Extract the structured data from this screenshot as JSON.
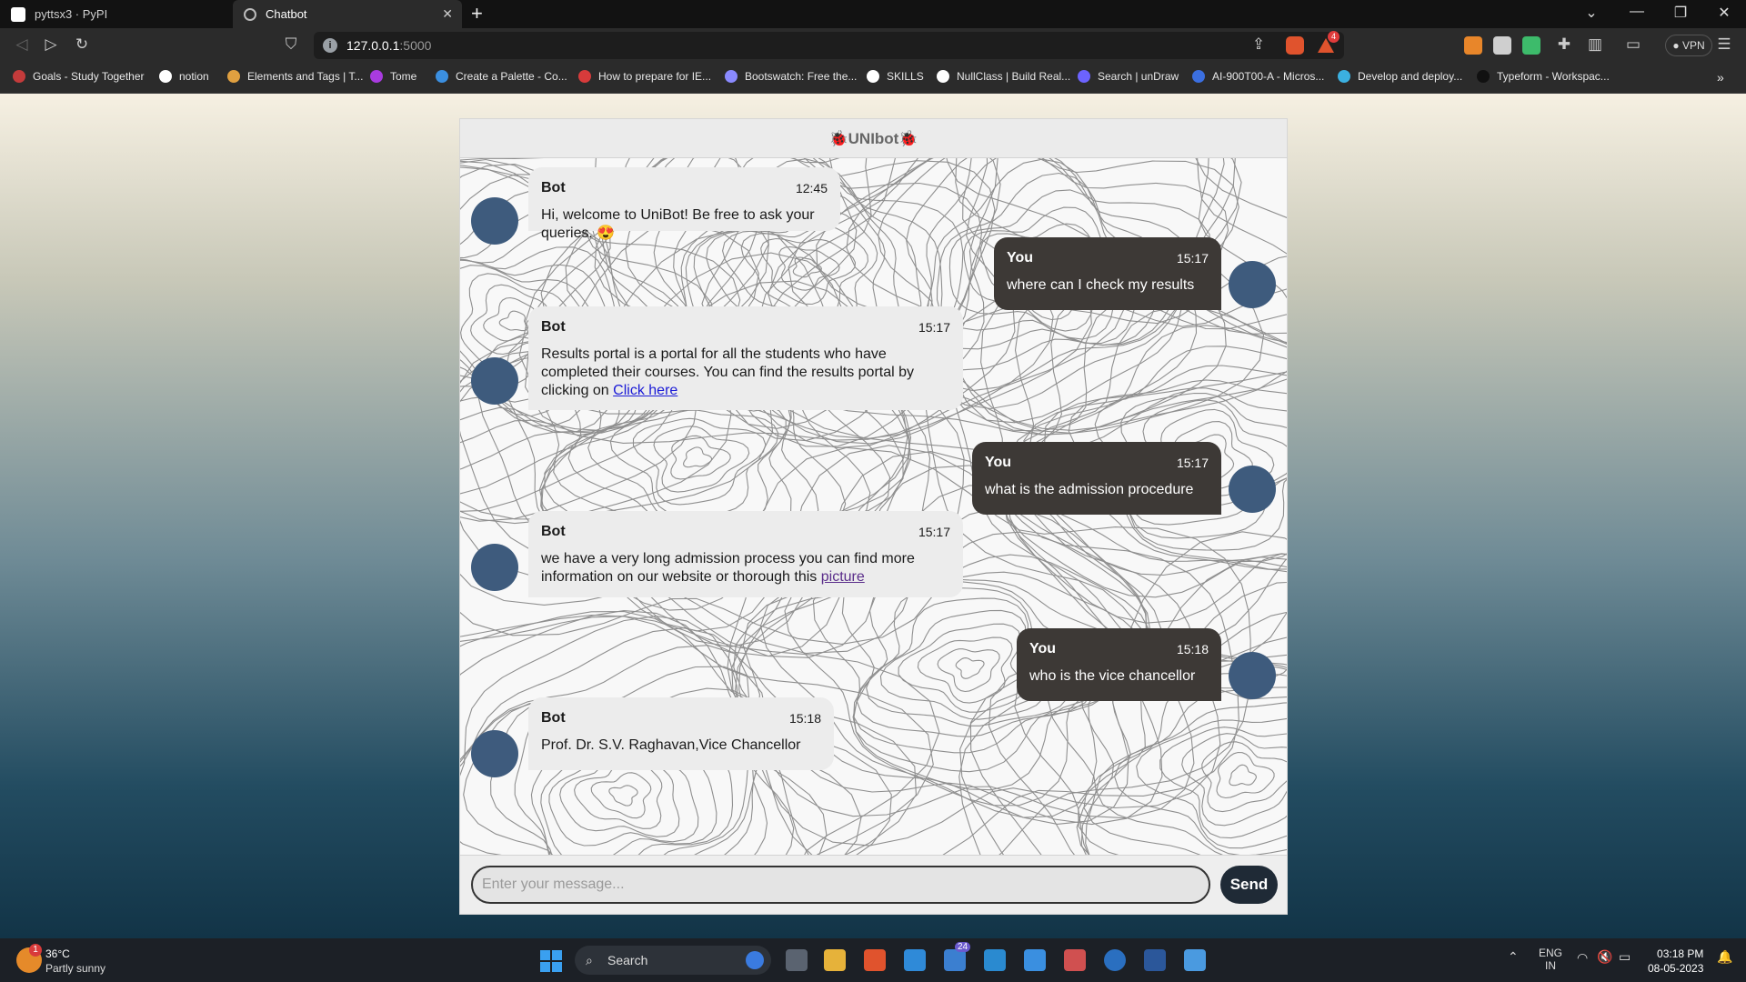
{
  "browser": {
    "tabs": [
      {
        "title": "pyttsx3 · PyPI",
        "active": false
      },
      {
        "title": "Chatbot",
        "active": true
      }
    ],
    "url_host": "127.0.0.1",
    "url_port": ":5000",
    "vpn_label": "VPN",
    "notification_count": "4",
    "bookmarks": [
      {
        "label": "Goals - Study Together",
        "color": "#c43b3b"
      },
      {
        "label": "notion",
        "color": "#ffffff"
      },
      {
        "label": "Elements and Tags | T...",
        "color": "#e0a040"
      },
      {
        "label": "Tome",
        "color": "#a93be0"
      },
      {
        "label": "Create a Palette - Co...",
        "color": "#3b8fe0"
      },
      {
        "label": "How to prepare for IE...",
        "color": "#d83b3b"
      },
      {
        "label": "Bootswatch: Free the...",
        "color": "#8a8aff"
      },
      {
        "label": "SKILLS",
        "color": "#ffffff"
      },
      {
        "label": "NullClass | Build Real...",
        "color": "#ffffff"
      },
      {
        "label": "Search | unDraw",
        "color": "#6c63ff"
      },
      {
        "label": "AI-900T00-A - Micros...",
        "color": "#3b6fe0"
      },
      {
        "label": "Develop and deploy...",
        "color": "#3bb0e0"
      },
      {
        "label": "Typeform - Workspac...",
        "color": "#111111"
      }
    ]
  },
  "chat": {
    "title": "UNIbot",
    "messages": [
      {
        "sender": "Bot",
        "time": "12:45",
        "text": "Hi, welcome to UniBot! Be free to ask your queries. 😍"
      },
      {
        "sender": "You",
        "time": "15:17",
        "text": "where can I check my results"
      },
      {
        "sender": "Bot",
        "time": "15:17",
        "text": "Results portal is a portal for all the students who have completed their courses. You can find the results portal by clicking on ",
        "link_text": "Click here"
      },
      {
        "sender": "You",
        "time": "15:17",
        "text": "what is the admission procedure"
      },
      {
        "sender": "Bot",
        "time": "15:17",
        "text": "we have a very long admission process you can find more information on our website or thorough this ",
        "link_text": "picture"
      },
      {
        "sender": "You",
        "time": "15:18",
        "text": "who is the vice chancellor"
      },
      {
        "sender": "Bot",
        "time": "15:18",
        "text": "Prof. Dr. S.V. Raghavan,Vice Chancellor"
      }
    ],
    "input_placeholder": "Enter your message...",
    "send_label": "Send",
    "colors": {
      "bot_bubble": "#ececec",
      "user_bubble": "#3d3936",
      "avatar": "#3e5b7d",
      "send_button": "#1f2a36"
    }
  },
  "taskbar": {
    "weather_temp": "36°C",
    "weather_desc": "Partly sunny",
    "weather_badge": "1",
    "search_label": "Search",
    "mail_badge": "24",
    "lang_top": "ENG",
    "lang_bottom": "IN",
    "time": "03:18 PM",
    "date": "08-05-2023"
  }
}
